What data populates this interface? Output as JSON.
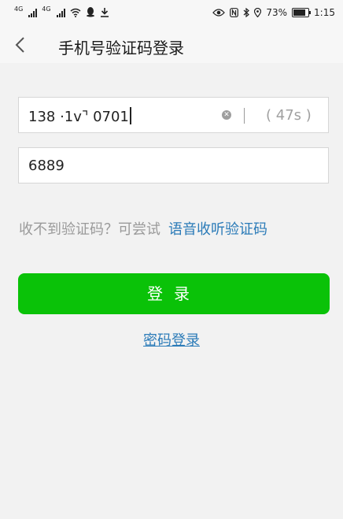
{
  "status_bar": {
    "net1": "4G",
    "net2": "4G",
    "battery_pct": "73%",
    "battery_level": 0.73,
    "time": "1:15",
    "icons": [
      "signal-icon",
      "signal-icon",
      "wifi-icon",
      "qq-icon",
      "download-icon",
      "eye-icon",
      "nfc-icon",
      "bluetooth-icon",
      "location-icon",
      "battery-icon"
    ]
  },
  "header": {
    "title": "手机号验证码登录",
    "back_icon": "chevron-left-icon"
  },
  "phone_field": {
    "value": "138 ·1ᴠ⌝ 0701",
    "countdown": "( 47s )"
  },
  "code_field": {
    "value": "6889"
  },
  "hint": {
    "text": "收不到验证码？可尝试",
    "link": "语音收听验证码"
  },
  "login_button": {
    "label": "登录"
  },
  "password_login_link": {
    "label": "密码登录"
  },
  "colors": {
    "primary_green": "#0ac208",
    "link_blue": "#2b7bb8",
    "background": "#f2f2f2"
  }
}
